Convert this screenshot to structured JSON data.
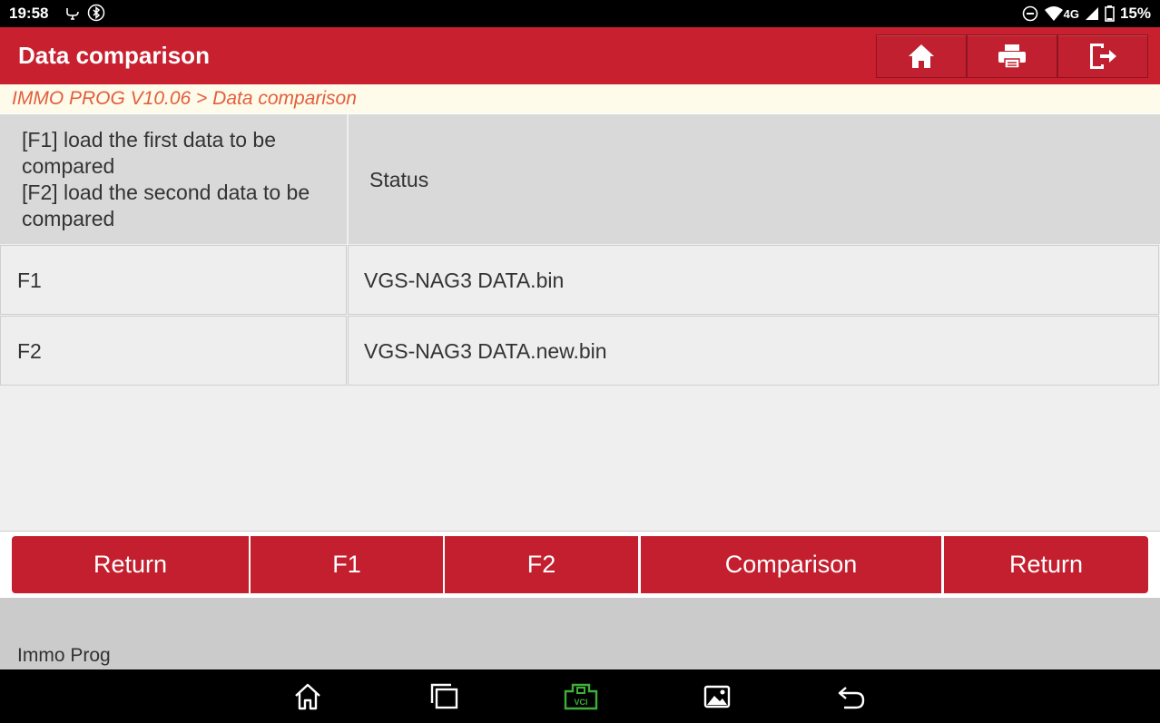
{
  "status_bar": {
    "time": "19:58",
    "network": "4G",
    "battery": "15%",
    "icons_left": [
      "usb-debug-icon",
      "bluetooth-icon"
    ],
    "icons_right": [
      "dnd-icon",
      "wifi-icon",
      "signal-icon",
      "battery-icon"
    ]
  },
  "header": {
    "title": "Data comparison",
    "buttons": [
      "home-icon",
      "print-icon",
      "exit-icon"
    ]
  },
  "breadcrumb": "IMMO PROG V10.06 > Data comparison",
  "table": {
    "header_left_lines": [
      "[F1] load the first data to be",
      "compared",
      "[F2] load the second data to be",
      "compared"
    ],
    "header_right": "Status",
    "rows": [
      {
        "key": "F1",
        "value": "VGS-NAG3 DATA.bin"
      },
      {
        "key": "F2",
        "value": "VGS-NAG3 DATA.new.bin"
      }
    ]
  },
  "buttons": {
    "return_left": "Return",
    "f1": "F1",
    "f2": "F2",
    "comparison": "Comparison",
    "return_right": "Return"
  },
  "footer": {
    "label": "Immo Prog"
  },
  "nav": {
    "icons": [
      "nav-home-icon",
      "recents-icon",
      "vci-icon",
      "gallery-icon",
      "back-icon"
    ],
    "vci_label": "VCI",
    "vci_color": "#3fae3a"
  },
  "colors": {
    "accent": "#c8202f",
    "breadcrumb_text": "#e25e3c"
  }
}
